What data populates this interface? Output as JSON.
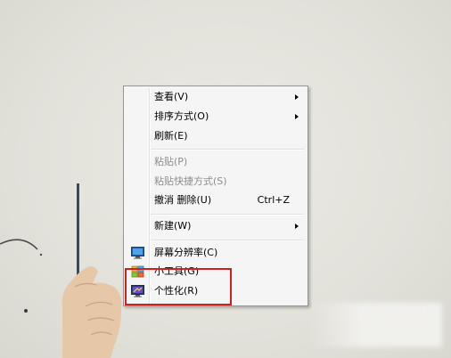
{
  "context_menu": {
    "items": [
      {
        "label": "查看(V)",
        "has_submenu": true,
        "enabled": true
      },
      {
        "label": "排序方式(O)",
        "has_submenu": true,
        "enabled": true
      },
      {
        "label": "刷新(E)",
        "has_submenu": false,
        "enabled": true
      },
      {
        "label": "粘贴(P)",
        "has_submenu": false,
        "enabled": false
      },
      {
        "label": "粘贴快捷方式(S)",
        "has_submenu": false,
        "enabled": false
      },
      {
        "label": "撤消 删除(U)",
        "shortcut": "Ctrl+Z",
        "has_submenu": false,
        "enabled": true
      },
      {
        "label": "新建(W)",
        "has_submenu": true,
        "enabled": true
      },
      {
        "label": "屏幕分辨率(C)",
        "icon": "display-icon",
        "has_submenu": false,
        "enabled": true
      },
      {
        "label": "小工具(G)",
        "icon": "gadgets-icon",
        "has_submenu": false,
        "enabled": true
      },
      {
        "label": "个性化(R)",
        "icon": "personalize-icon",
        "has_submenu": false,
        "enabled": true
      }
    ]
  },
  "annotation": {
    "color": "#d21f1f",
    "target": "个性化(R)"
  },
  "colors": {
    "menu_background": "#f5f5f5",
    "menu_border": "#979797",
    "disabled_text": "#8d8d8d",
    "desktop_background": "#e5e4dd"
  }
}
